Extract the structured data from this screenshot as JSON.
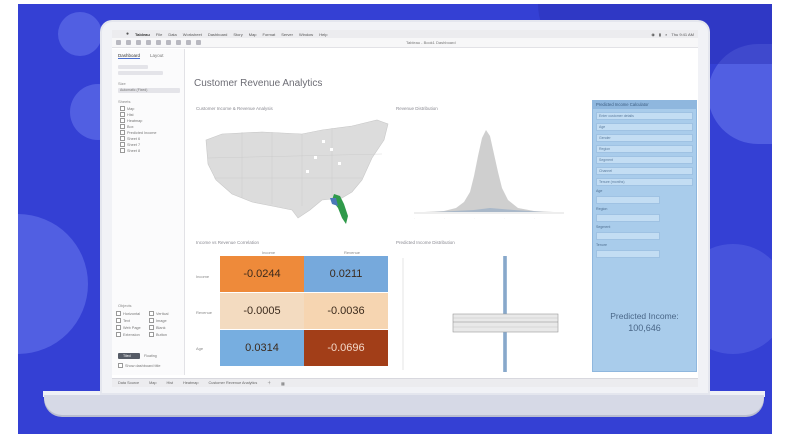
{
  "app": {
    "menu": [
      "Tableau",
      "File",
      "Data",
      "Worksheet",
      "Dashboard",
      "Story",
      "Map",
      "Format",
      "Server",
      "Window",
      "Help"
    ],
    "window_title": "Tableau - Book1 Dashboard",
    "clock": "Thu 9:41 AM"
  },
  "left_panel": {
    "tabs": [
      "Dashboard",
      "Layout"
    ],
    "size_label": "Size",
    "size_value": "Automatic (Fixed)",
    "sheets_label": "Sheets",
    "sheets": [
      "Map",
      "Hist",
      "Heatmap",
      "Box",
      "Predicted Income",
      "Sheet 6",
      "Sheet 7",
      "Sheet 8"
    ],
    "objects_label": "Objects",
    "objects": [
      "Horizontal",
      "Vertical",
      "Text",
      "Image",
      "Web Page",
      "Blank",
      "Extension",
      "Button"
    ],
    "tiled_label": "Tiled",
    "floating_label": "Floating",
    "show_title": "Show dashboard title"
  },
  "dashboard": {
    "title": "Customer Revenue Analytics",
    "map_caption": "Customer Income & Revenue Analysis",
    "hist_caption": "Revenue Distribution",
    "heat_caption": "Income vs Revenue Correlation",
    "box_caption": "Predicted Income Distribution",
    "heatmap": {
      "col_labels": [
        "Income",
        "Revenue"
      ],
      "row_labels": [
        "Income",
        "Revenue",
        "Age"
      ],
      "cells": [
        [
          "-0.0244",
          "0.0211"
        ],
        [
          "-0.0005",
          "-0.0036"
        ],
        [
          "0.0314",
          "-0.0696"
        ]
      ],
      "colors": [
        [
          "#ee8a3a",
          "#76a9dc"
        ],
        [
          "#f3dbc0",
          "#f6d5b1"
        ],
        [
          "#77aee0",
          "#a23e18"
        ]
      ]
    }
  },
  "right_panel": {
    "header": "Predicted Income Calculator",
    "fields": [
      "Enter customer details",
      "Age",
      "Gender",
      "Region",
      "Segment",
      "Channel",
      "Tenure (months)"
    ],
    "labels": [
      "Age",
      "Region",
      "Segment",
      "Tenure"
    ],
    "result_label": "Predicted Income:",
    "result_value": "100,646"
  },
  "statusbar": {
    "items": [
      "Data Source",
      "Map",
      "Hist",
      "Heatmap",
      "Customer Revenue Analytics"
    ]
  },
  "colors": {
    "background_blue": "#3440d4",
    "accent_panel": "#a9cceb"
  }
}
